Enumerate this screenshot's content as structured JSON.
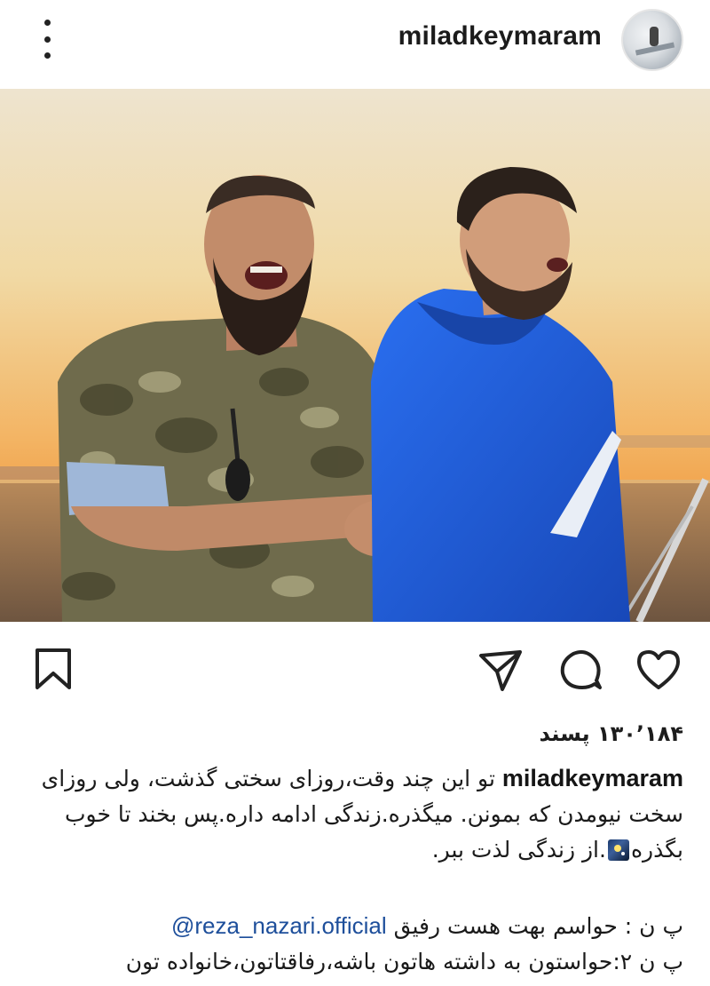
{
  "header": {
    "username": "miladkeymaram",
    "menu_icon": "more-vertical-icon"
  },
  "post": {
    "tag_icon": "user-tag-icon"
  },
  "actions": {
    "bookmark_icon": "bookmark-icon",
    "share_icon": "send-icon",
    "comment_icon": "comment-icon",
    "like_icon": "heart-icon"
  },
  "likes": {
    "text": "۱۳۰٬۱۸۴ پسند"
  },
  "caption": {
    "username": "miladkeymaram",
    "text_part1": "تو این چند وقت،روزای سختی گذشت، ولی روزای سخت نیومدن که بمونن. میگذره.زندگی ادامه داره.پس بخند تا خوب بگذره",
    "emoji": "night-sky-emoji",
    "text_part2": ".از زندگی لذت ببر."
  },
  "comments": [
    {
      "prefix": "پ ن : حواسم بهت هست رفیق ",
      "mention": "@reza_nazari.official"
    },
    {
      "text": "پ ن ۲:حواستون به داشته هاتون باشه،رفاقتاتون،خانواده تون"
    }
  ],
  "colors": {
    "mention": "#1e4f9b",
    "sky_top": "#f2e6c8",
    "sky_bottom": "#f4a24a",
    "hoodie": "#1f5fd6"
  }
}
